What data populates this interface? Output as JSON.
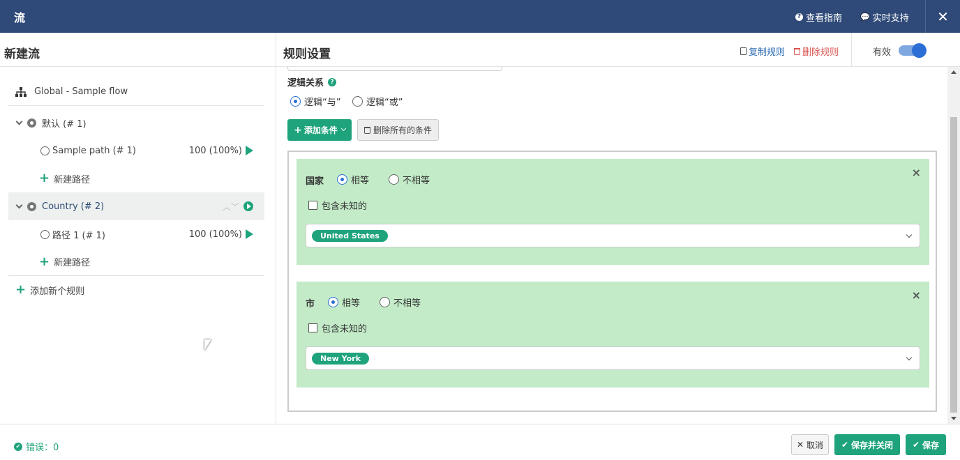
{
  "topbar": {
    "title": "流",
    "help_label": "查看指南",
    "support_label": "实时支持",
    "close_glyph": "✕"
  },
  "left_panel": {
    "title": "新建流",
    "flow_name": "Global - Sample flow",
    "rules": [
      {
        "label": "默认 (# 1)",
        "paths": [
          {
            "label": "Sample path (# 1)",
            "percent": "100 (100%)"
          }
        ],
        "add_path_label": "新建路径"
      },
      {
        "label": "Country (# 2)",
        "paths": [
          {
            "label": "路径 1 (# 1)",
            "percent": "100 (100%)"
          }
        ],
        "add_path_label": "新建路径"
      }
    ],
    "add_rule_label": "添加新个规则"
  },
  "right_panel": {
    "title": "规则设置",
    "copy_rule_label": "复制规则",
    "delete_rule_label": "删除规则",
    "valid_label": "有效",
    "valid_on": true,
    "logic_label": "逻辑关系",
    "logic_options": [
      "逻辑“与”",
      "逻辑“或”"
    ],
    "logic_selected": 0,
    "add_condition_label": "添加条件",
    "delete_all_label": "删除所有的条件",
    "conditions": [
      {
        "field": "国家",
        "options": [
          "相等",
          "不相等"
        ],
        "selected": 0,
        "include_unknown_label": "包含未知的",
        "include_unknown": false,
        "tags": [
          "United States"
        ]
      },
      {
        "field": "市",
        "options": [
          "相等",
          "不相等"
        ],
        "selected": 0,
        "include_unknown_label": "包含未知的",
        "include_unknown": false,
        "tags": [
          "New York"
        ]
      }
    ]
  },
  "footer": {
    "errors_label": "错误：0",
    "cancel_label": "取消",
    "save_close_label": "保存并关闭",
    "save_label": "保存"
  },
  "colors": {
    "topbar": "#2f4a78",
    "accent": "#1fa37c",
    "condition_bg": "#c3ebc8",
    "link_blue": "#2f6eb3",
    "danger": "#d9534f",
    "toggle": "#2b6fd6"
  }
}
